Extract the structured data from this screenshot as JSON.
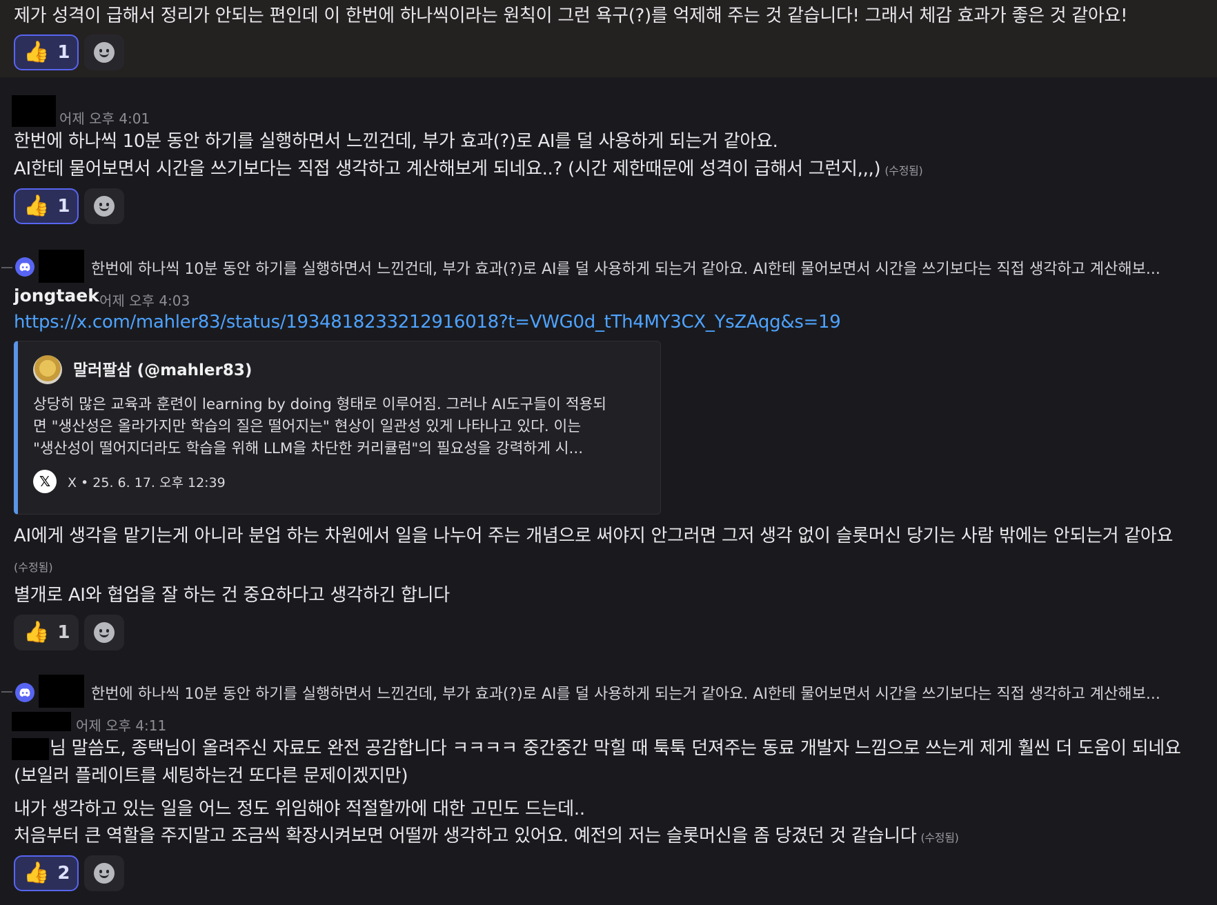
{
  "messages": {
    "m0": {
      "text": "제가 성격이 급해서 정리가 안되는 편인데 이 한번에 하나씩이라는 원칙이 그런 욕구(?)를 억제해 주는 것 같습니다! 그래서 체감 효과가 좋은 것 같아요!",
      "reaction": {
        "emoji": "👍",
        "count": "1"
      }
    },
    "m1": {
      "timestamp": "어제 오후 4:01",
      "line1": "한번에 하나씩 10분 동안 하기를 실행하면서 느낀건데, 부가 효과(?)로 AI를 덜 사용하게 되는거 같아요.",
      "line2": "AI한테 물어보면서 시간을 쓰기보다는 직접 생각하고 계산해보게 되네요..? (시간 제한때문에 성격이 급해서 그런지,,,)",
      "edited": "(수정됨)",
      "reaction": {
        "emoji": "👍",
        "count": "1"
      }
    },
    "m2": {
      "reply_preview": "한번에 하나씩 10분 동안 하기를 실행하면서 느낀건데, 부가 효과(?)로 AI를 덜 사용하게 되는거 같아요.  AI한테 물어보면서 시간을 쓰기보다는 직접 생각하고 계산해보...",
      "username": "jongtaek",
      "timestamp": "어제 오후 4:03",
      "link": "https://x.com/mahler83/status/1934818233212916018?t=VWG0d_tTh4MY3CX_YsZAqg&s=19",
      "embed": {
        "author": "말러팔삼 (@mahler83)",
        "desc_line1": "상당히 많은 교육과 훈련이 learning by doing 형태로 이루어짐. 그러나 AI도구들이 적용되",
        "desc_line2": "면 \"생산성은 올라가지만 학습의 질은 떨어지는\" 현상이 일관성 있게 나타나고 있다. 이는",
        "desc_line3": "\"생산성이 떨어지더라도 학습을 위해 LLM을 차단한 커리큘럼\"의 필요성을 강력하게 시...",
        "footer": "X • 25. 6. 17. 오후 12:39"
      },
      "text1": "AI에게 생각을 맡기는게 아니라 분업 하는 차원에서 일을 나누어 주는 개념으로 써야지 안그러면 그저 생각 없이 슬롯머신 당기는 사람 밖에는 안되는거 같아요",
      "edited": "(수정됨)",
      "text2": "별개로 AI와 협업을 잘 하는 건 중요하다고 생각하긴 합니다",
      "reaction": {
        "emoji": "👍",
        "count": "1"
      }
    },
    "m3": {
      "reply_preview": "한번에 하나씩 10분 동안 하기를 실행하면서 느낀건데, 부가 효과(?)로 AI를 덜 사용하게 되는거 같아요.  AI한테 물어보면서 시간을 쓰기보다는 직접 생각하고 계산해보...",
      "timestamp": "어제 오후 4:11",
      "line1": "님 말씀도, 종택님이 올려주신 자료도 완전 공감합니다 ㅋㅋㅋㅋ 중간중간 막힐 때 툭툭 던져주는 동료 개발자 느낌으로 쓰는게 제게 훨씬 더 도움이 되네요",
      "line2": "(보일러 플레이트를 세팅하는건 또다른 문제이겠지만)",
      "line3": "내가 생각하고 있는 일을 어느 정도 위임해야 적절할까에 대한 고민도 드는데..",
      "line4": "처음부터 큰 역할을 주지말고 조금씩 확장시켜보면 어떨까 생각하고 있어요. 예전의 저는 슬롯머신을 좀 당겼던 것 같습니다",
      "edited": "(수정됨)",
      "reaction": {
        "emoji": "👍",
        "count": "2"
      }
    }
  },
  "icons": {
    "add_reaction": "smile-plus-icon",
    "reply_app": "discord-icon",
    "embed_source": "x-logo-icon"
  },
  "colors": {
    "accent": "#5865f2",
    "link": "#4ea3ff",
    "background": "#1a1a1e"
  }
}
